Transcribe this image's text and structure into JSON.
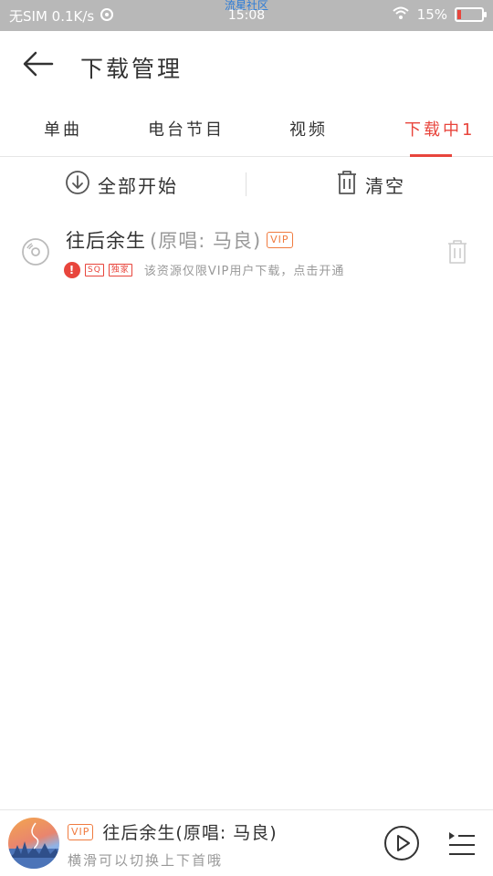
{
  "status_bar": {
    "carrier": "无SIM 0.1K/s",
    "community": "流星社区",
    "time": "15:08",
    "battery": "15%",
    "battery_level": 0.15
  },
  "header": {
    "title": "下载管理"
  },
  "tabs": [
    {
      "label": "单曲"
    },
    {
      "label": "电台节目"
    },
    {
      "label": "视频"
    },
    {
      "label": "下载中1",
      "active": true
    }
  ],
  "actions": {
    "start_all": "全部开始",
    "clear": "清空"
  },
  "download_item": {
    "title": "往后余生",
    "original": "(原唱: 马良)",
    "vip_badge": "VIP",
    "sq_badge": "SQ",
    "exclusive_badge": "独家",
    "message": "该资源仅限VIP用户下载，点击开通"
  },
  "player": {
    "vip_badge": "VIP",
    "title": "往后余生(原唱: 马良)",
    "hint": "横滑可以切换上下首哦"
  },
  "colors": {
    "accent": "#e8453c",
    "vip": "#f07b3f",
    "status_bar": "#b8b8b8"
  }
}
